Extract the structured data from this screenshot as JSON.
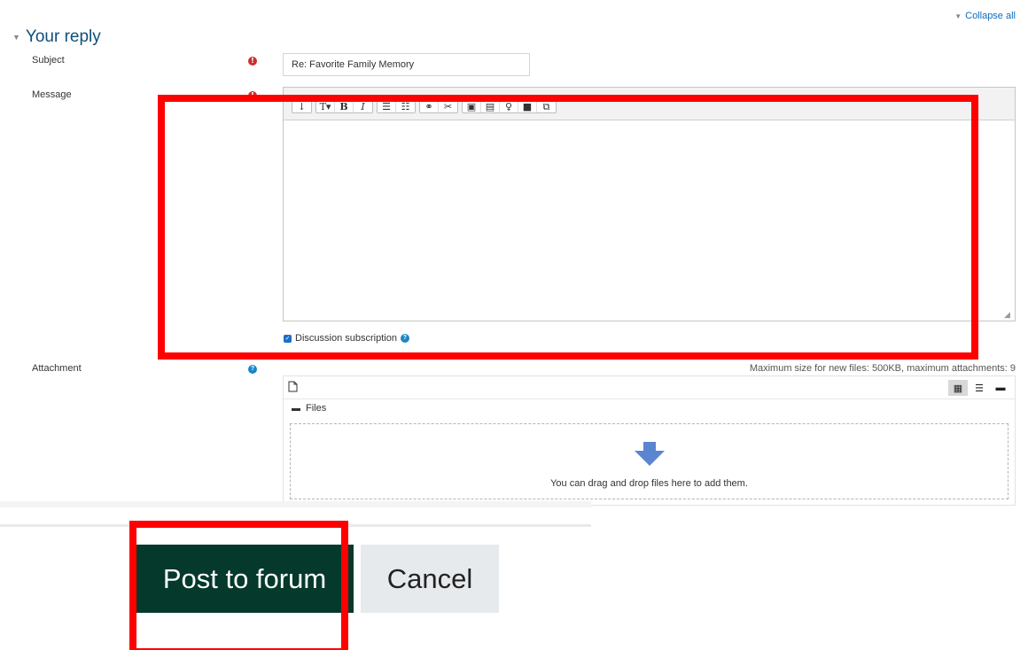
{
  "header": {
    "collapse_all": "Collapse all",
    "section_title": "Your reply"
  },
  "form": {
    "subject_label": "Subject",
    "subject_value": "Re: Favorite Family Memory",
    "message_label": "Message",
    "message_value": "",
    "subscription_label": "Discussion subscription",
    "subscription_checked": true,
    "attachment_label": "Attachment"
  },
  "editor_toolbar": {
    "groups": [
      [
        "arrow-down-icon"
      ],
      [
        "text-style-icon",
        "bold-icon",
        "italic-icon"
      ],
      [
        "bullet-list-icon",
        "numbered-list-icon"
      ],
      [
        "link-icon",
        "unlink-icon"
      ],
      [
        "image-icon",
        "media-icon",
        "record-audio-icon",
        "record-video-icon",
        "copy-icon"
      ]
    ]
  },
  "filepicker": {
    "max_size_text": "Maximum size for new files: 500KB, maximum attachments: 9",
    "path_label": "Files",
    "drop_text": "You can drag and drop files here to add them."
  },
  "buttons": {
    "post": "Post to forum",
    "cancel": "Cancel"
  },
  "colors": {
    "post_button_bg": "#04392b",
    "cancel_button_bg": "#e7eaed",
    "highlight_box": "#ff0000",
    "section_title": "#0f4f7a",
    "required_icon": "#c9302c",
    "help_icon": "#1c86c5"
  }
}
